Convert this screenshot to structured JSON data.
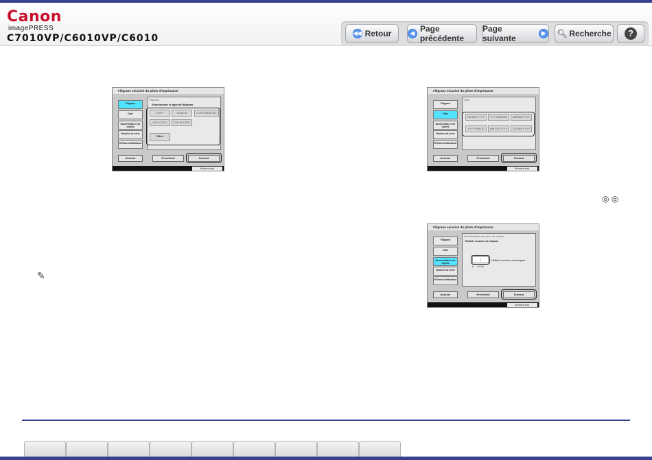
{
  "header": {
    "brand": "Canon",
    "product": "imagePRESS",
    "model": "C7010VP/C6010VP/C6010"
  },
  "nav": {
    "back": "Retour",
    "prev": "Page précédente",
    "next": "Page suivante",
    "search": "Recherche",
    "help": "?"
  },
  "screens": {
    "common": {
      "title": "Filigrane sécurisé du pilote d'imprimante",
      "tabs": [
        "Filigrane",
        "Date",
        "Numérotatio\nn de copies",
        "Numéro\nde série",
        "N°/Nom\nd'utilisateur"
      ],
      "cancel": "Annuler",
      "previous": "Précédent",
      "next": "Suivant",
      "monitor": "Moniteur syst."
    },
    "watermark": {
      "section": "Filigrane",
      "prompt": "Sélectionner le type de filigrane.",
      "options": [
        "COPY",
        "INVALID",
        "CONFIDENTIAL",
        "FILE COPY",
        "TOP SECRET"
      ],
      "other": "Other"
    },
    "date": {
      "section": "Date",
      "options": [
        "DD/MM/YYYY",
        "YYYY/MM/DD",
        "MM/DD/YYYY",
        "YYYY.MM.DD",
        "MM.DD.YYYY",
        "DD.MM.YYYY"
      ]
    },
    "copy": {
      "section": "Numérotation des jeux de copies",
      "prompt": "Définir numéro de départ.",
      "value": "1",
      "hint": "Utiliser touches numériques",
      "range": "(1 - 9999)"
    }
  },
  "tune_icons": "◎ ◎"
}
